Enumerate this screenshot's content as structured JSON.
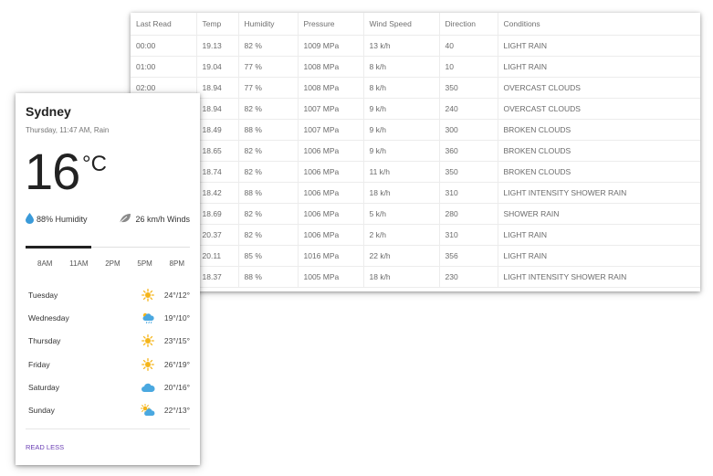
{
  "table": {
    "headers": [
      "Last Read",
      "Temp",
      "Humidity",
      "Pressure",
      "Wind Speed",
      "Direction",
      "Conditions"
    ],
    "rows": [
      [
        "00:00",
        "19.13",
        "82 %",
        "1009 MPa",
        "13 k/h",
        "40",
        "LIGHT RAIN"
      ],
      [
        "01:00",
        "19.04",
        "77 %",
        "1008 MPa",
        "8 k/h",
        "10",
        "LIGHT RAIN"
      ],
      [
        "02:00",
        "18.94",
        "77 %",
        "1008 MPa",
        "8 k/h",
        "350",
        "OVERCAST CLOUDS"
      ],
      [
        "",
        "18.94",
        "82 %",
        "1007 MPa",
        "9 k/h",
        "240",
        "OVERCAST CLOUDS"
      ],
      [
        "",
        "18.49",
        "88 %",
        "1007 MPa",
        "9 k/h",
        "300",
        "BROKEN CLOUDS"
      ],
      [
        "",
        "18.65",
        "82 %",
        "1006 MPa",
        "9 k/h",
        "360",
        "BROKEN CLOUDS"
      ],
      [
        "",
        "18.74",
        "82 %",
        "1006 MPa",
        "11 k/h",
        "350",
        "BROKEN CLOUDS"
      ],
      [
        "",
        "18.42",
        "88 %",
        "1006 MPa",
        "18 k/h",
        "310",
        "LIGHT INTENSITY SHOWER RAIN"
      ],
      [
        "",
        "18.69",
        "82 %",
        "1006 MPa",
        "5 k/h",
        "280",
        "SHOWER RAIN"
      ],
      [
        "",
        "20.37",
        "82 %",
        "1006 MPa",
        "2 k/h",
        "310",
        "LIGHT RAIN"
      ],
      [
        "",
        "20.11",
        "85 %",
        "1016 MPa",
        "22 k/h",
        "356",
        "LIGHT RAIN"
      ],
      [
        "",
        "18.37",
        "88 %",
        "1005 MPa",
        "18 k/h",
        "230",
        "LIGHT INTENSITY SHOWER RAIN"
      ]
    ]
  },
  "weather": {
    "city": "Sydney",
    "subtitle": "Thursday, 11:47 AM, Rain",
    "temperature": "16",
    "unit": "°C",
    "humidity": "88% Humidity",
    "wind": "26 km/h Winds",
    "slider_fraction": 0.4,
    "times": [
      "8AM",
      "11AM",
      "2PM",
      "5PM",
      "8PM"
    ],
    "forecast": [
      {
        "day": "Tuesday",
        "icon": "sun-icon",
        "range": "24°/12°"
      },
      {
        "day": "Wednesday",
        "icon": "cloud-rain-icon",
        "range": "19°/10°"
      },
      {
        "day": "Thursday",
        "icon": "sun-icon",
        "range": "23°/15°"
      },
      {
        "day": "Friday",
        "icon": "sun-icon",
        "range": "26°/19°"
      },
      {
        "day": "Saturday",
        "icon": "cloud-icon",
        "range": "20°/16°"
      },
      {
        "day": "Sunday",
        "icon": "partly-cloudy-icon",
        "range": "22°/13°"
      }
    ],
    "read_less": "READ LESS"
  },
  "colors": {
    "sun": "#f5b51a",
    "cloud": "#4aa8e0",
    "link": "#6a3fb4"
  }
}
